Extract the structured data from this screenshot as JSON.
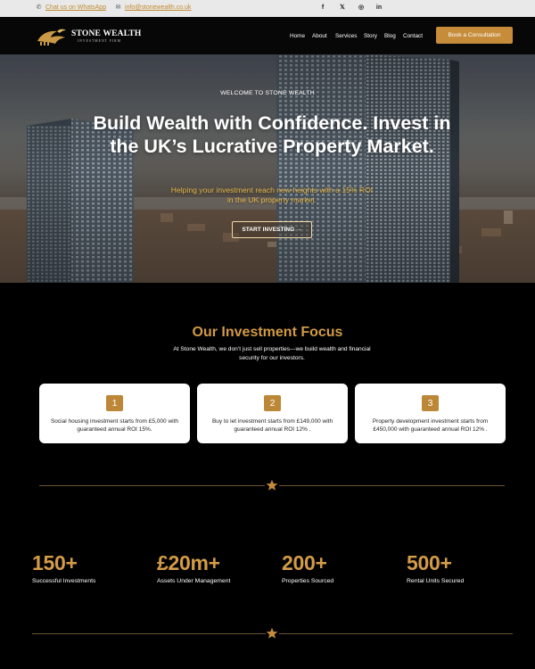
{
  "topbar": {
    "whatsapp_icon": "whatsapp-icon",
    "whatsapp_label": "Chat us on WhatsApp",
    "email_icon": "envelope-icon",
    "email_label": "info@stonewealth.co.uk",
    "social": [
      {
        "name": "facebook-icon",
        "glyph": "f"
      },
      {
        "name": "x-icon",
        "glyph": "𝕏"
      },
      {
        "name": "instagram-icon",
        "glyph": "◎"
      },
      {
        "name": "linkedin-icon",
        "glyph": "in"
      }
    ]
  },
  "nav": {
    "brand": "STONE WEALTH",
    "brand_sub": "INVESTMENT FIRM",
    "items": [
      "Home",
      "About",
      "Services",
      "Story",
      "Blog",
      "Contact"
    ],
    "cta": "Book a Consultation"
  },
  "hero": {
    "eyebrow": "WELCOME TO STONE WEALTH",
    "headline": "Build Wealth with Confidence. Invest in the UK’s Lucrative Property Market.",
    "tagline": "Helping your investment reach new heights with a 15% ROI in the UK property market.",
    "button": "START INVESTING →"
  },
  "focus": {
    "title": "Our Investment Focus",
    "subtitle": "At Stone Wealth, we don’t just sell properties—we build wealth and financial security for our investors.",
    "cards": [
      {
        "number": "1",
        "text": "Social housing investment starts from £5,000 with guaranteed annual ROI 15%."
      },
      {
        "number": "2",
        "text": "Buy to let investment starts from £149,000 with guaranteed annual ROI 12% ."
      },
      {
        "number": "3",
        "text": "Property development investment starts from £450,000 with guaranteed annual ROI 12% ."
      }
    ]
  },
  "stats": [
    {
      "value": "150+",
      "label": "Successful Investments"
    },
    {
      "value": "£20m+",
      "label": "Assets Under Management"
    },
    {
      "value": "200+",
      "label": "Properties Sourced"
    },
    {
      "value": "500+",
      "label": "Rental Units Secured"
    }
  ],
  "colors": {
    "accent": "#c68c3a",
    "accent_text": "#d19a43",
    "background": "#000000",
    "topbar": "#e9e9e9"
  }
}
